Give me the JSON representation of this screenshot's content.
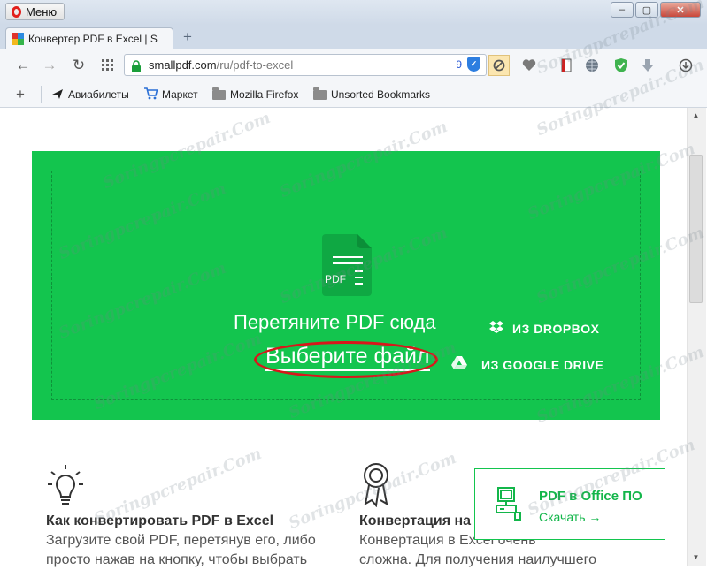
{
  "browser": {
    "menu_label": "Меню",
    "tab_title": "Конвертер PDF в Excel | S",
    "new_tab_symbol": "+",
    "url_domain": "smallpdf.com",
    "url_path": "/ru/pdf-to-excel",
    "blocked_count": "9",
    "window_controls": [
      "–",
      "▢",
      "✕"
    ]
  },
  "bookmarks": [
    {
      "label": "Авиабилеты",
      "icon": "plane-icon"
    },
    {
      "label": "Маркет",
      "icon": "cart-icon"
    },
    {
      "label": "Mozilla Firefox",
      "icon": "folder-icon"
    },
    {
      "label": "Unsorted Bookmarks",
      "icon": "folder-icon"
    }
  ],
  "upload": {
    "file_type_label": "PDF",
    "drop_text": "Перетяните PDF сюда",
    "choose_file": "Выберите файл",
    "dropbox_label": "ИЗ DROPBOX",
    "gdrive_label": "ИЗ GOOGLE DRIVE",
    "accent_color": "#13c54e"
  },
  "features": [
    {
      "icon": "lightbulb-icon",
      "title": "Как конвертировать PDF в Excel",
      "line1": "Загрузите свой PDF, перетянув его, либо",
      "line2": "просто нажав на кнопку, чтобы выбрать"
    },
    {
      "icon": "award-icon",
      "title": "Конвертация на",
      "line1": "Конвертация в Excel очень",
      "line2": "сложна. Для получения наилучшего"
    }
  ],
  "office_promo": {
    "title": "PDF в Office ПО",
    "link": "Скачать →"
  },
  "watermark": "Soringpcrepair.Com"
}
